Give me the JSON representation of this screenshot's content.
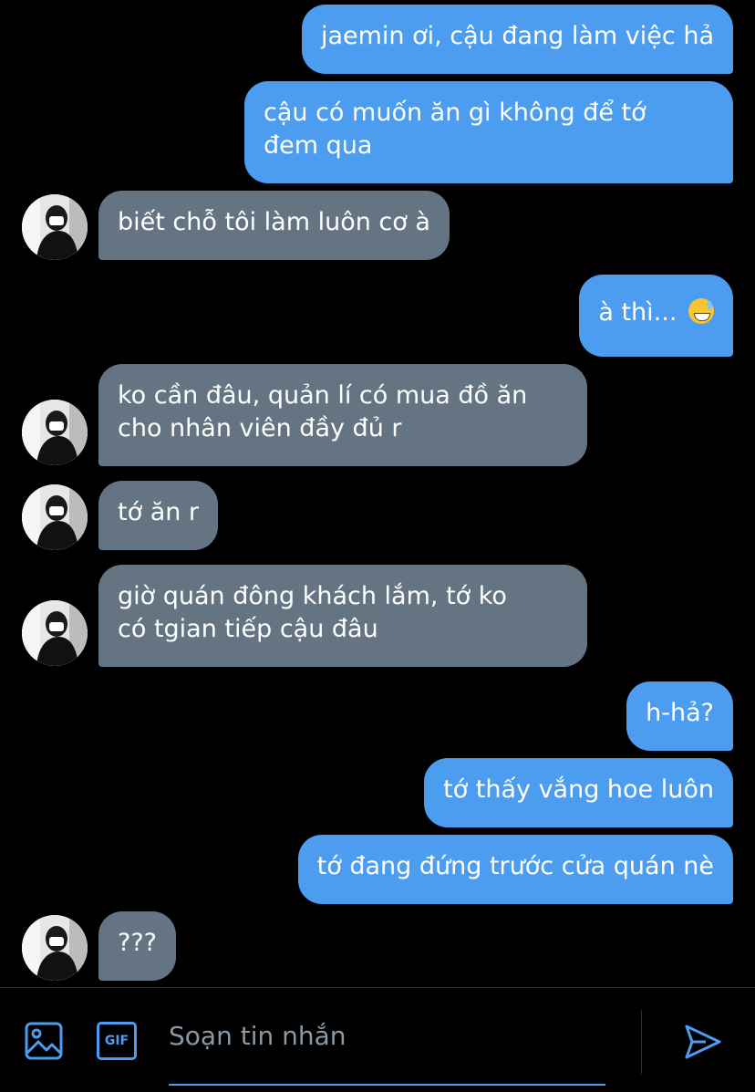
{
  "conversation": {
    "messages": [
      {
        "id": "m1",
        "direction": "out",
        "text": "jaemin ơi, cậu đang làm việc hả"
      },
      {
        "id": "m2",
        "direction": "out",
        "lines": [
          "cậu có muốn ăn gì không để tớ",
          "đem qua"
        ]
      },
      {
        "id": "m3",
        "direction": "in",
        "text": "biết chỗ tôi làm luôn cơ à"
      },
      {
        "id": "m4",
        "direction": "out",
        "text": "à thì...",
        "emoji": "grinning-sweat-emoji"
      },
      {
        "id": "m5",
        "direction": "in",
        "lines": [
          "ko cần đâu, quản lí có mua đồ ăn",
          "cho nhân viên đầy đủ r"
        ]
      },
      {
        "id": "m6",
        "direction": "in",
        "text": "tớ ăn r"
      },
      {
        "id": "m7",
        "direction": "in",
        "lines": [
          "giờ quán đông khách lắm, tớ ko",
          "có tgian tiếp cậu đâu"
        ]
      },
      {
        "id": "m8",
        "direction": "out",
        "text": "h-hả?"
      },
      {
        "id": "m9",
        "direction": "out",
        "text": "tớ thấy vắng hoe luôn"
      },
      {
        "id": "m10",
        "direction": "out",
        "text": "tớ đang đứng trước cửa quán nè"
      },
      {
        "id": "m11",
        "direction": "in",
        "text": "???"
      }
    ]
  },
  "composer": {
    "placeholder": "Soạn tin nhắn",
    "gif_label": "GIF",
    "icons": [
      "image-icon",
      "gif-icon",
      "send-icon"
    ]
  },
  "colors": {
    "background": "#000000",
    "outgoing_bubble": "#4c9df0",
    "incoming_bubble": "#657482",
    "accent": "#4c9df0",
    "placeholder_text": "#8b98a5"
  }
}
